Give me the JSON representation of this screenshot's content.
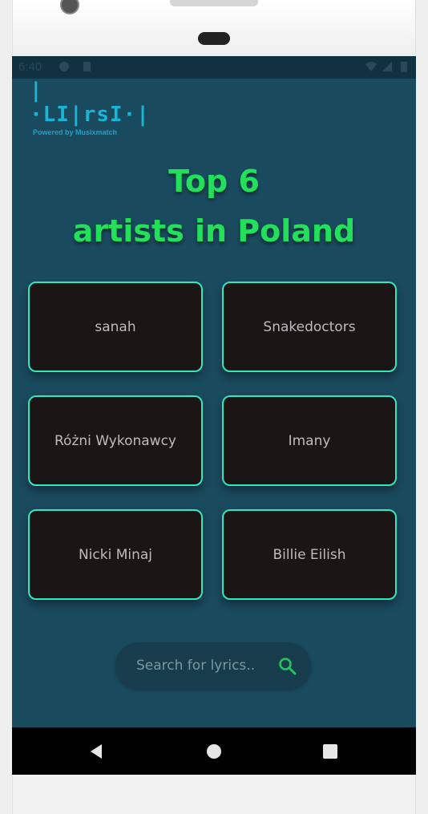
{
  "status_bar": {
    "time": "6:40"
  },
  "brand": {
    "logo_text": "|·LI|rsI·|",
    "powered_by": "Powered by Musixmatch"
  },
  "headline": {
    "line1": "Top 6",
    "line2": "artists in Poland"
  },
  "artists": [
    {
      "name": "sanah"
    },
    {
      "name": "Snakedoctors"
    },
    {
      "name": "Różni Wykonawcy"
    },
    {
      "name": "Imany"
    },
    {
      "name": "Nicki Minaj"
    },
    {
      "name": "Billie Eilish"
    }
  ],
  "search": {
    "placeholder": "Search for lyrics.."
  },
  "colors": {
    "background": "#1a4a5e",
    "accent_green": "#22e05a",
    "card_border": "#33e6bb",
    "card_fill": "#1c1516"
  },
  "icons": {
    "search": "search-icon",
    "back": "back-triangle-icon",
    "home": "home-circle-icon",
    "recents": "recents-square-icon"
  }
}
